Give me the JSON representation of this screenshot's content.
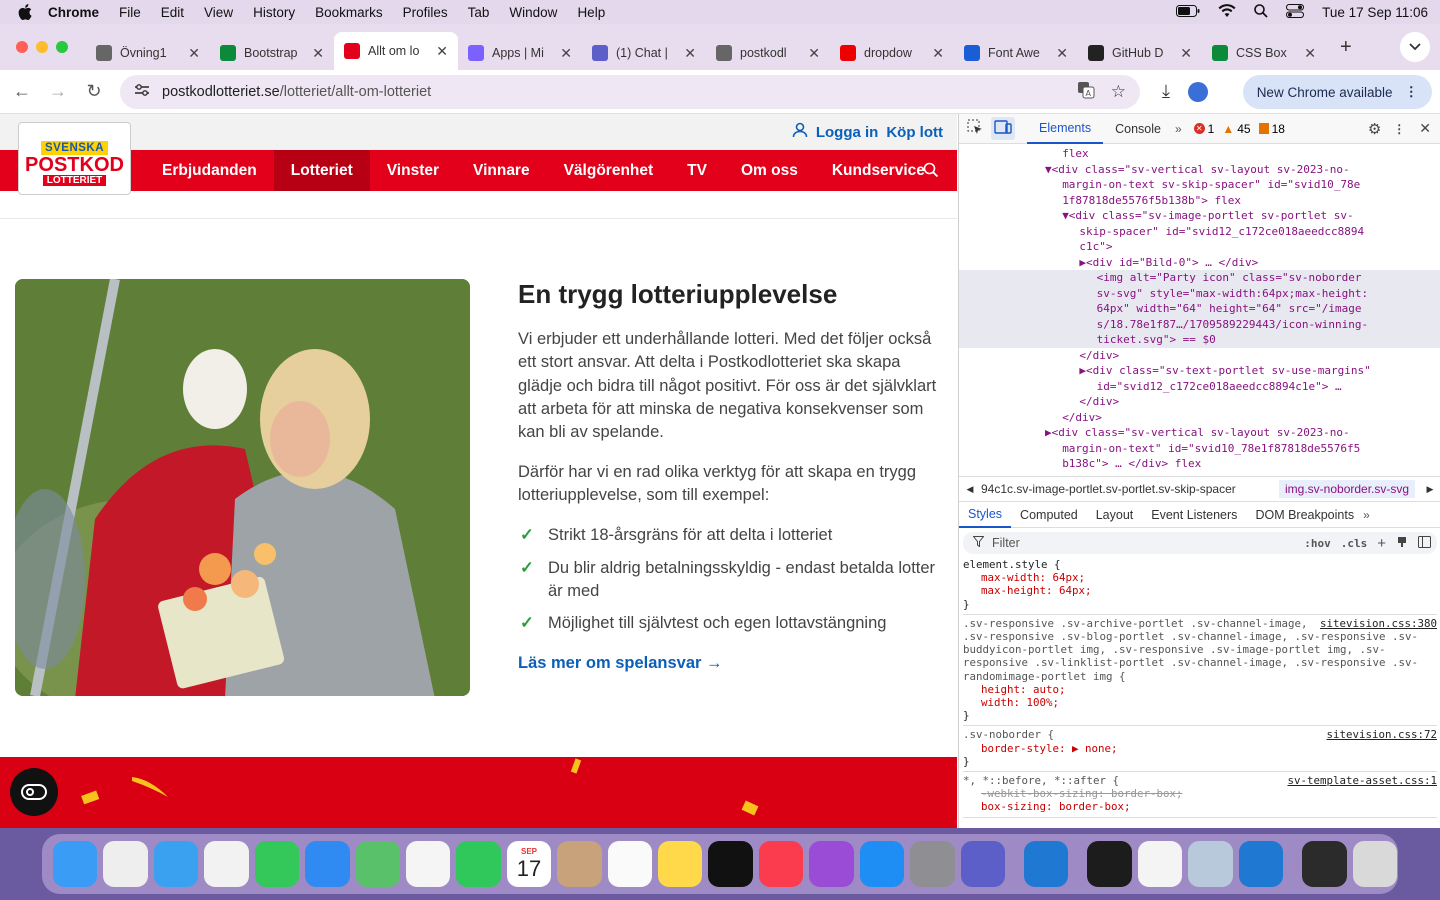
{
  "menubar": {
    "app": "Chrome",
    "items": [
      "File",
      "Edit",
      "View",
      "History",
      "Bookmarks",
      "Profiles",
      "Tab",
      "Window",
      "Help"
    ],
    "clock": "Tue 17 Sep  11:06"
  },
  "tabs": [
    {
      "title": "Övning1",
      "color": "#666"
    },
    {
      "title": "Bootstrap",
      "color": "#0b8a3a"
    },
    {
      "title": "Allt om lo",
      "color": "#e2001a",
      "active": true
    },
    {
      "title": "Apps | Mi",
      "color": "#7b61ff"
    },
    {
      "title": "(1) Chat |",
      "color": "#5b5fc7"
    },
    {
      "title": "postkodl",
      "color": "#666"
    },
    {
      "title": "dropdow",
      "color": "#e00"
    },
    {
      "title": "Font Awe",
      "color": "#1b5dd7"
    },
    {
      "title": "GitHub D",
      "color": "#222"
    },
    {
      "title": "CSS Box",
      "color": "#0b8a3a"
    }
  ],
  "toolbar": {
    "url_domain": "postkodlotteriet.se",
    "url_path": "/lotteriet/allt-om-lotteriet",
    "new_chrome": "New Chrome available"
  },
  "site": {
    "logo": {
      "line1": "SVENSKA",
      "line2": "POSTKOD",
      "line3": "LOTTERIET"
    },
    "login": "Logga in",
    "buy": "Köp lott",
    "nav": [
      "Erbjudanden",
      "Lotteriet",
      "Vinster",
      "Vinnare",
      "Välgörenhet",
      "TV",
      "Om oss",
      "Kundservice"
    ],
    "active_nav": "Lotteriet",
    "heading": "En trygg lotteriupplevelse",
    "para1": "Vi erbjuder ett underhållande lotteri. Med det följer också ett stort ansvar. Att delta i Postkodlotteriet ska skapa glädje och bidra till något positivt. För oss är det självklart att arbeta för att minska de negativa konsekvenser som kan bli av spelande.",
    "para2": "Därför har vi en rad olika verktyg för att skapa en trygg lotteriupplevelse, som till exempel:",
    "checks": [
      "Strikt 18-årsgräns för att delta i lotteriet",
      "Du blir aldrig betalningsskyldig - endast betalda lotter är med",
      "Möjlighet till självtest och egen lottavstängning"
    ],
    "readmore": "Läs mer om spelansvar →"
  },
  "devtools": {
    "tabs": [
      "Elements",
      "Console"
    ],
    "errors": "1",
    "warnings": "45",
    "issues": "18",
    "dom_lines": [
      {
        "indent": 12,
        "text": "flex"
      },
      {
        "indent": 10,
        "text": "▼<div class=\"sv-vertical sv-layout sv-2023-no-"
      },
      {
        "indent": 12,
        "text": "margin-on-text sv-skip-spacer\" id=\"svid10_78e"
      },
      {
        "indent": 12,
        "text": "1f87818de5576f5b138b\"> flex"
      },
      {
        "indent": 12,
        "text": "▼<div class=\"sv-image-portlet sv-portlet sv-"
      },
      {
        "indent": 14,
        "text": "skip-spacer\" id=\"svid12_c172ce018aeedcc8894"
      },
      {
        "indent": 14,
        "text": "c1c\">"
      },
      {
        "indent": 14,
        "text": "▶<div id=\"Bild-0\"> … </div>"
      },
      {
        "indent": 16,
        "text": "<img alt=\"Party icon\" class=\"sv-noborder",
        "sel": true
      },
      {
        "indent": 16,
        "text": "sv-svg\" style=\"max-width:64px;max-height:",
        "sel": true
      },
      {
        "indent": 16,
        "text": "64px\" width=\"64\" height=\"64\" src=\"/image",
        "sel": true
      },
      {
        "indent": 16,
        "text": "s/18.78e1f87…/1709589229443/icon-winning-",
        "sel": true
      },
      {
        "indent": 16,
        "text": "ticket.svg\"> == $0",
        "sel": true
      },
      {
        "indent": 14,
        "text": "</div>"
      },
      {
        "indent": 14,
        "text": "▶<div class=\"sv-text-portlet sv-use-margins\""
      },
      {
        "indent": 16,
        "text": "id=\"svid12_c172ce018aeedcc8894c1e\"> …"
      },
      {
        "indent": 14,
        "text": "</div>"
      },
      {
        "indent": 12,
        "text": "</div>"
      },
      {
        "indent": 10,
        "text": "▶<div class=\"sv-vertical sv-layout sv-2023-no-"
      },
      {
        "indent": 12,
        "text": "margin-on-text\" id=\"svid10_78e1f87818de5576f5"
      },
      {
        "indent": 12,
        "text": "b138c\"> … </div> flex"
      }
    ],
    "crumb1": "94c1c.sv-image-portlet.sv-portlet.sv-skip-spacer",
    "crumb2": "img.sv-noborder.sv-svg",
    "subtabs": [
      "Styles",
      "Computed",
      "Layout",
      "Event Listeners",
      "DOM Breakpoints"
    ],
    "filter": "Filter",
    "hov": ":hov",
    "cls": ".cls",
    "rules": [
      {
        "selector": "element.style {",
        "src": "",
        "props": [
          "max-width: 64px;",
          "max-height: 64px;"
        ]
      },
      {
        "selector": ".sv-responsive .sv-archive-portlet .sv-channel-image, .sv-responsive .sv-blog-portlet .sv-channel-image, .sv-responsive .sv-buddyicon-portlet img, .sv-responsive .sv-image-portlet img, .sv-responsive .sv-linklist-portlet .sv-channel-image, .sv-responsive .sv-randomimage-portlet img {",
        "src": "sitevision.css:380",
        "props": [
          "height: auto;",
          "width: 100%;"
        ]
      },
      {
        "selector": ".sv-noborder {",
        "src": "sitevision.css:72",
        "props": [
          "border-style: ▶ none;"
        ]
      },
      {
        "selector": "*, *::before, *::after {",
        "src": "sv-template-asset.css:1",
        "props": [
          "-webkit-box-sizing: border-box;",
          "box-sizing: border-box;"
        ]
      }
    ]
  },
  "dock": {
    "apps": [
      {
        "name": "finder",
        "color": "#3b9cf5"
      },
      {
        "name": "launchpad",
        "color": "#eee"
      },
      {
        "name": "safari",
        "color": "#3aa0f0"
      },
      {
        "name": "chrome",
        "color": "#f2f2f2"
      },
      {
        "name": "messages",
        "color": "#34c759"
      },
      {
        "name": "mail",
        "color": "#2f8bf2"
      },
      {
        "name": "maps",
        "color": "#5ac16b"
      },
      {
        "name": "photos",
        "color": "#f5f5f5"
      },
      {
        "name": "facetime",
        "color": "#30c85a"
      },
      {
        "name": "calendar",
        "color": "#ffffff"
      },
      {
        "name": "contacts",
        "color": "#c7a27a"
      },
      {
        "name": "reminders",
        "color": "#fafafa"
      },
      {
        "name": "notes",
        "color": "#ffd94a"
      },
      {
        "name": "tv",
        "color": "#111"
      },
      {
        "name": "music",
        "color": "#fb3c4f"
      },
      {
        "name": "podcasts",
        "color": "#9b4cd6"
      },
      {
        "name": "appstore",
        "color": "#1e8ef5"
      },
      {
        "name": "settings",
        "color": "#8e8e93"
      },
      {
        "name": "teams",
        "color": "#5b5fc7"
      },
      {
        "name": "vscode",
        "color": "#1f78d1"
      },
      {
        "name": "terminal",
        "color": "#1c1c1c"
      },
      {
        "name": "textedit",
        "color": "#f4f4f4"
      },
      {
        "name": "preview",
        "color": "#b7c9da"
      },
      {
        "name": "vscode-2",
        "color": "#1f78d1"
      },
      {
        "name": "screenshot",
        "color": "#2b2b2b"
      },
      {
        "name": "trash",
        "color": "#d9d9d9"
      }
    ],
    "calendar_month": "SEP",
    "calendar_day": "17"
  }
}
